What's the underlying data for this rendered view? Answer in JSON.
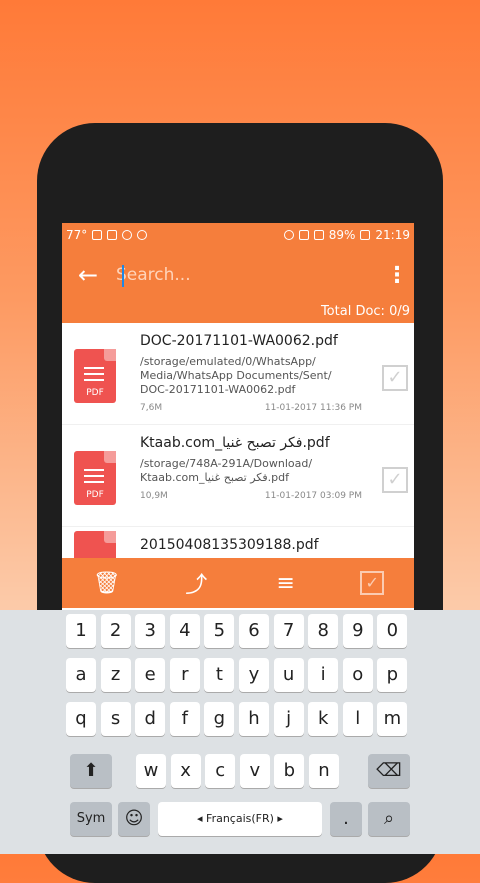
{
  "status": {
    "left_text": "77°",
    "battery": "89%",
    "time": "21:19"
  },
  "appbar": {
    "search_placeholder": "Search...",
    "total_docs": "Total Doc: 0/9"
  },
  "files": [
    {
      "name": "DOC-20171101-WA0062.pdf",
      "path": "/storage/emulated/0/WhatsApp/ Media/WhatsApp Documents/Sent/ DOC-20171101-WA0062.pdf",
      "size": "7,6M",
      "date": "11-01-2017 11:36 PM"
    },
    {
      "name": "Ktaab.com_فكر تصبح غنيا.pdf",
      "path": "/storage/748A-291A/Download/ Ktaab.com_فكر تصبح غنيا.pdf",
      "size": "10,9M",
      "date": "11-01-2017 03:09 PM"
    },
    {
      "name": "20150408135309188.pdf",
      "path": "",
      "size": "",
      "date": ""
    }
  ],
  "pdf_label": "PDF",
  "actions": [
    "delete-icon",
    "share-icon",
    "sort-icon",
    "select-all-icon"
  ],
  "keyboard": {
    "row_numbers": [
      "1",
      "2",
      "3",
      "4",
      "5",
      "6",
      "7",
      "8",
      "9",
      "0"
    ],
    "row1": [
      "a",
      "z",
      "e",
      "r",
      "t",
      "y",
      "u",
      "i",
      "o",
      "p"
    ],
    "row2": [
      "q",
      "s",
      "d",
      "f",
      "g",
      "h",
      "j",
      "k",
      "l",
      "m"
    ],
    "row3": [
      "w",
      "x",
      "c",
      "v",
      "b",
      "n"
    ],
    "shift": "⬆",
    "backspace": "⌫",
    "sym": "Sym",
    "space_label": "Français(FR)",
    "period": ".",
    "search_key": "🔍"
  },
  "colors": {
    "accent": "#f57e3c",
    "pdf": "#ef5350"
  }
}
